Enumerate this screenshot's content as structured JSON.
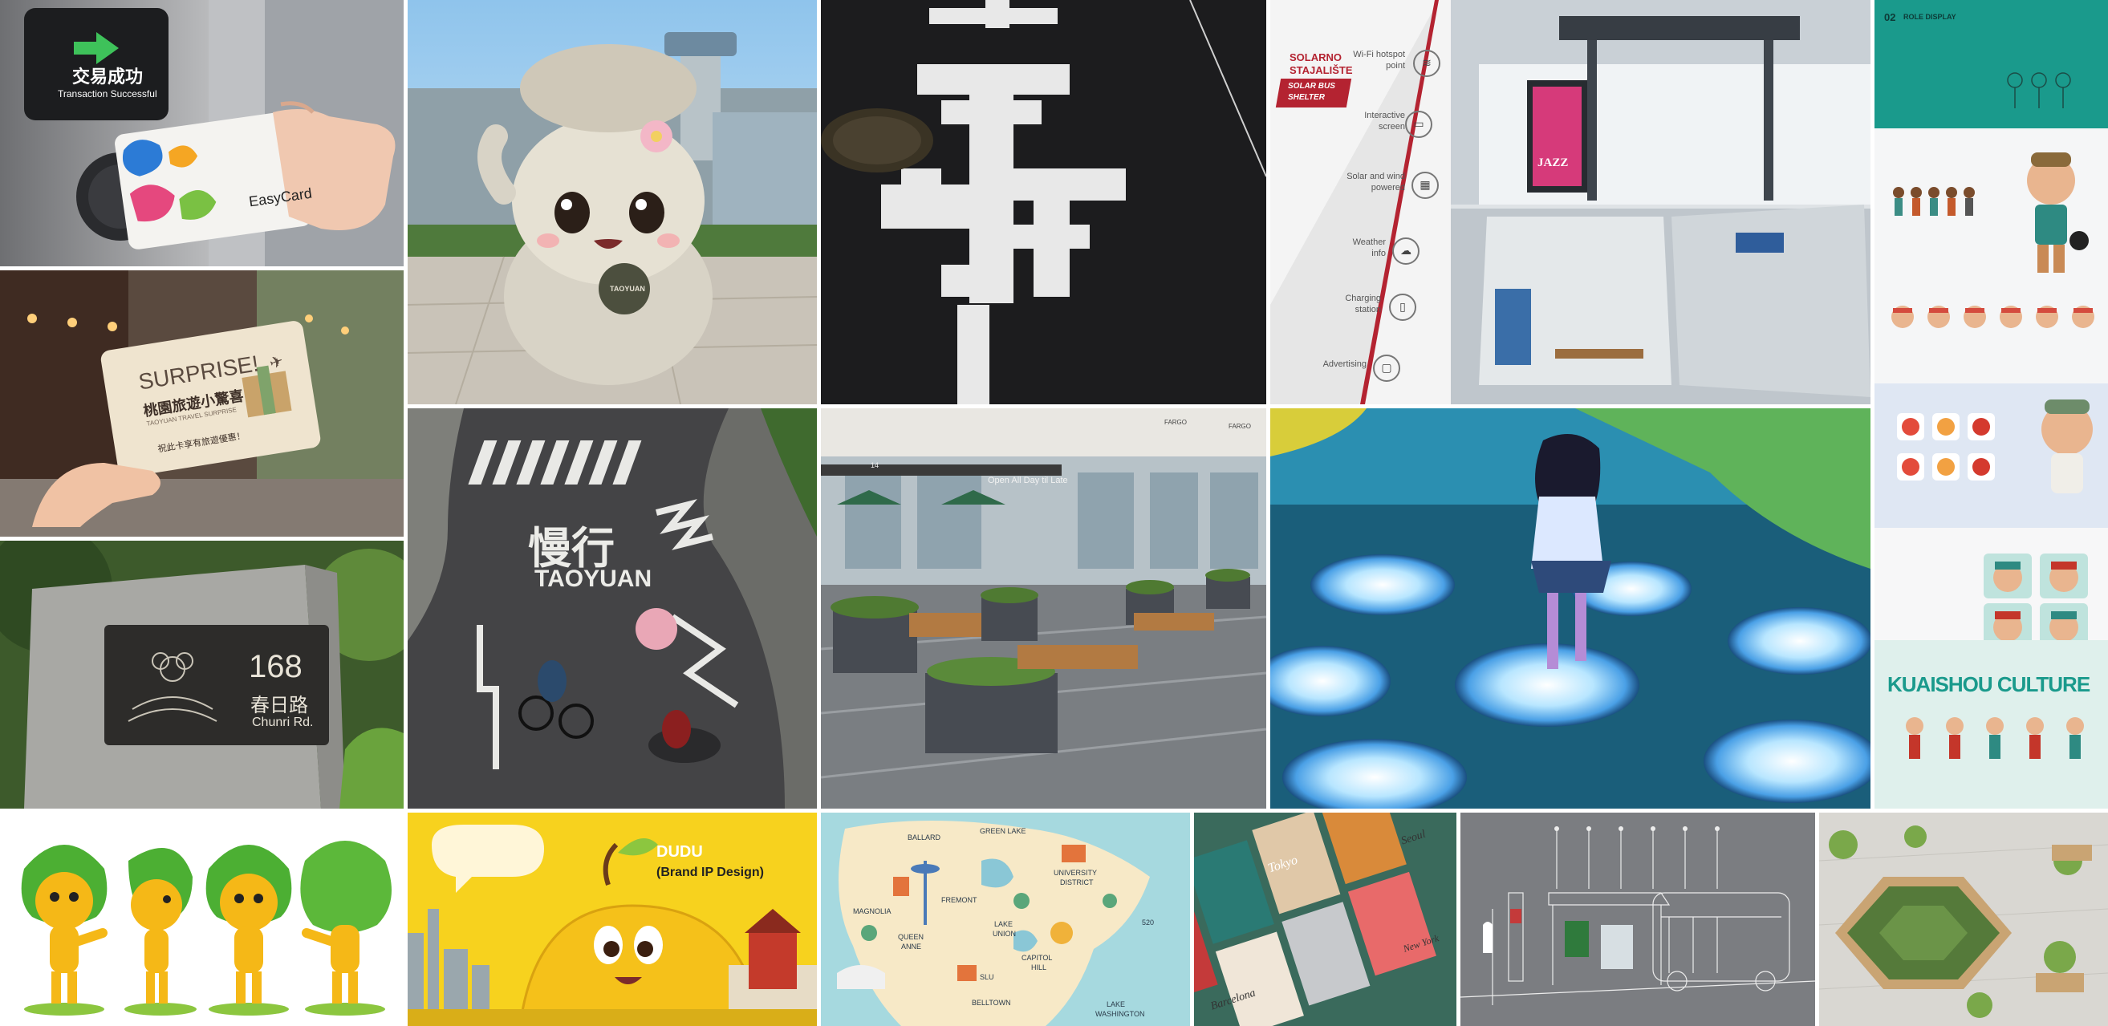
{
  "tiles": {
    "card_terminal": {
      "screen_title": "交易成功",
      "screen_subtitle": "Transaction Successful",
      "card_brand": "EasyCard"
    },
    "surprise_card": {
      "headline": "SURPRISE!",
      "title_zh": "桃園旅遊小驚喜",
      "subtitle": "TAOYUAN TRAVEL SURPRISE",
      "note_zh": "祝此卡享有旅遊優惠！"
    },
    "address_plaque": {
      "number": "168",
      "street_zh": "春日路",
      "street_en": "Chunri Rd."
    },
    "mascot_airport": {
      "bag_label": "TAOYUAN"
    },
    "road_marking": {
      "slow_zh": "慢行",
      "city": "TAOYUAN"
    },
    "plaza_cafe": {
      "storefront_sign": "Open All Day til Late",
      "shop_label_1": "FARGO",
      "shop_label_2": "FARGO",
      "unit_number": "14"
    },
    "bus_shelter_board": {
      "brand_1": "SOLARNO",
      "brand_2": "STAJALIŠTE",
      "tag_1": "SOLAR BUS",
      "tag_2": "SHELTER",
      "features": [
        {
          "label_1": "Wi-Fi hotspot",
          "label_2": "point",
          "icon": "wifi-icon"
        },
        {
          "label_1": "Interactive",
          "label_2": "screen",
          "icon": "touch-screen-icon"
        },
        {
          "label_1": "Solar and wind",
          "label_2": "powered",
          "icon": "solar-panel-icon"
        },
        {
          "label_1": "Weather",
          "label_2": "info",
          "icon": "cloud-icon"
        },
        {
          "label_1": "Charging",
          "label_2": "station",
          "icon": "phone-charge-icon"
        },
        {
          "label_1": "Advertising",
          "label_2": "",
          "icon": "ad-display-icon"
        }
      ],
      "poster_text": "JAZZ"
    },
    "role_sheet": {
      "heading_num": "02",
      "heading": "ROLE DISPLAY",
      "brand_banner": "KUAISHOU CULTURE"
    },
    "dudu_banner": {
      "name": "DUDU",
      "subtitle": "(Brand IP Design)"
    },
    "city_map": {
      "labels": [
        "BALLARD",
        "GREEN LAKE",
        "UNIVERSITY",
        "DISTRICT",
        "MAGNOLIA",
        "FREMONT",
        "QUEEN",
        "ANNE",
        "LAKE",
        "UNION",
        "CAPITOL",
        "HILL",
        "SLU",
        "BELLTOWN",
        "LAKE",
        "WASHINGTON",
        "520"
      ]
    },
    "map_books": {
      "titles": [
        "Tokyo",
        "Seoul",
        "Barcelona",
        "New York"
      ]
    }
  },
  "colors": {
    "teal": "#1a9a8c",
    "yellow": "#f7d21e",
    "road": "#2b2b2e",
    "gray_bg": "#7a7c80",
    "night_blue": "#123a5c"
  }
}
